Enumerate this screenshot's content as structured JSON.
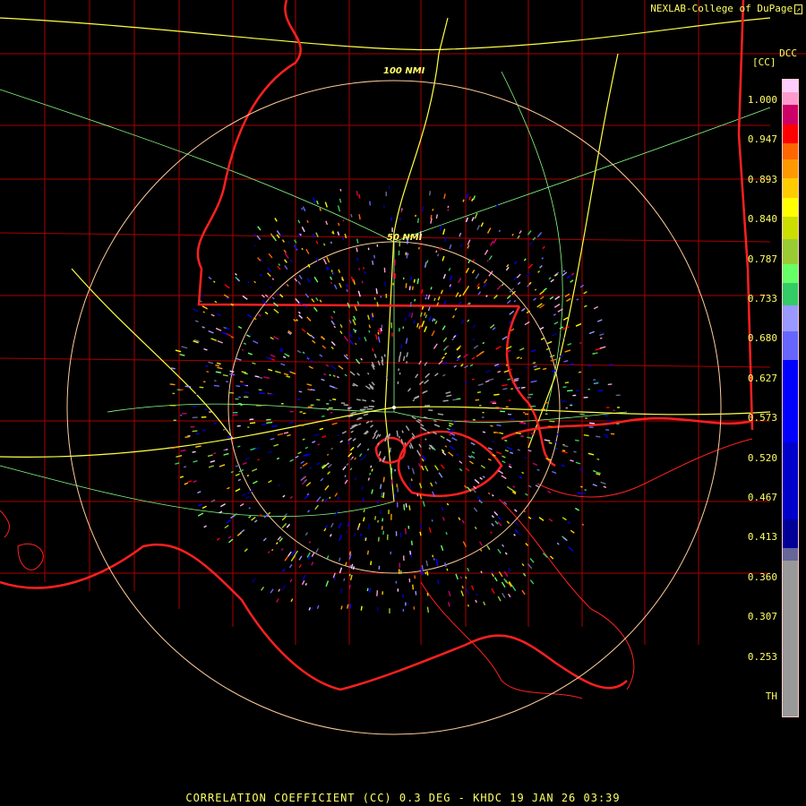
{
  "credit": "NEXLAB-College of DuPage",
  "product_code": "DCC",
  "units": "[CC]",
  "caption": "CORRELATION COEFFICIENT (CC) 0.3 DEG - KHDC 19 JAN 26 03:39",
  "range_rings": [
    "100 NMI",
    "50 NMI"
  ],
  "legend": {
    "ticks": [
      "1.000",
      "0.947",
      "0.893",
      "0.840",
      "0.787",
      "0.733",
      "0.680",
      "0.627",
      "0.573",
      "0.520",
      "0.467",
      "0.413",
      "0.360",
      "0.307",
      "0.253",
      "TH"
    ],
    "colors": [
      "#ffccff",
      "#ff99cc",
      "#cc0066",
      "#ff0000",
      "#ff6600",
      "#ff9900",
      "#ffcc00",
      "#ffff00",
      "#ccdd00",
      "#99cc33",
      "#66ff66",
      "#33cc66",
      "#9999ff",
      "#6666ff",
      "#0000ff",
      "#0000cc",
      "#000099",
      "#666699",
      "#999999",
      "#000000"
    ],
    "segments": [
      0.02,
      0.02,
      0.03,
      0.03,
      0.025,
      0.03,
      0.03,
      0.03,
      0.035,
      0.04,
      0.03,
      0.035,
      0.04,
      0.045,
      0.13,
      0.12,
      0.045,
      0.02,
      0.27,
      0.015
    ]
  },
  "colors": {
    "boundary": "#ff2020",
    "county": "#aa0000",
    "highway": "#ffff44",
    "road": "#88ff88",
    "ring": "#ffcc99",
    "accent_text": "#ffff66"
  }
}
